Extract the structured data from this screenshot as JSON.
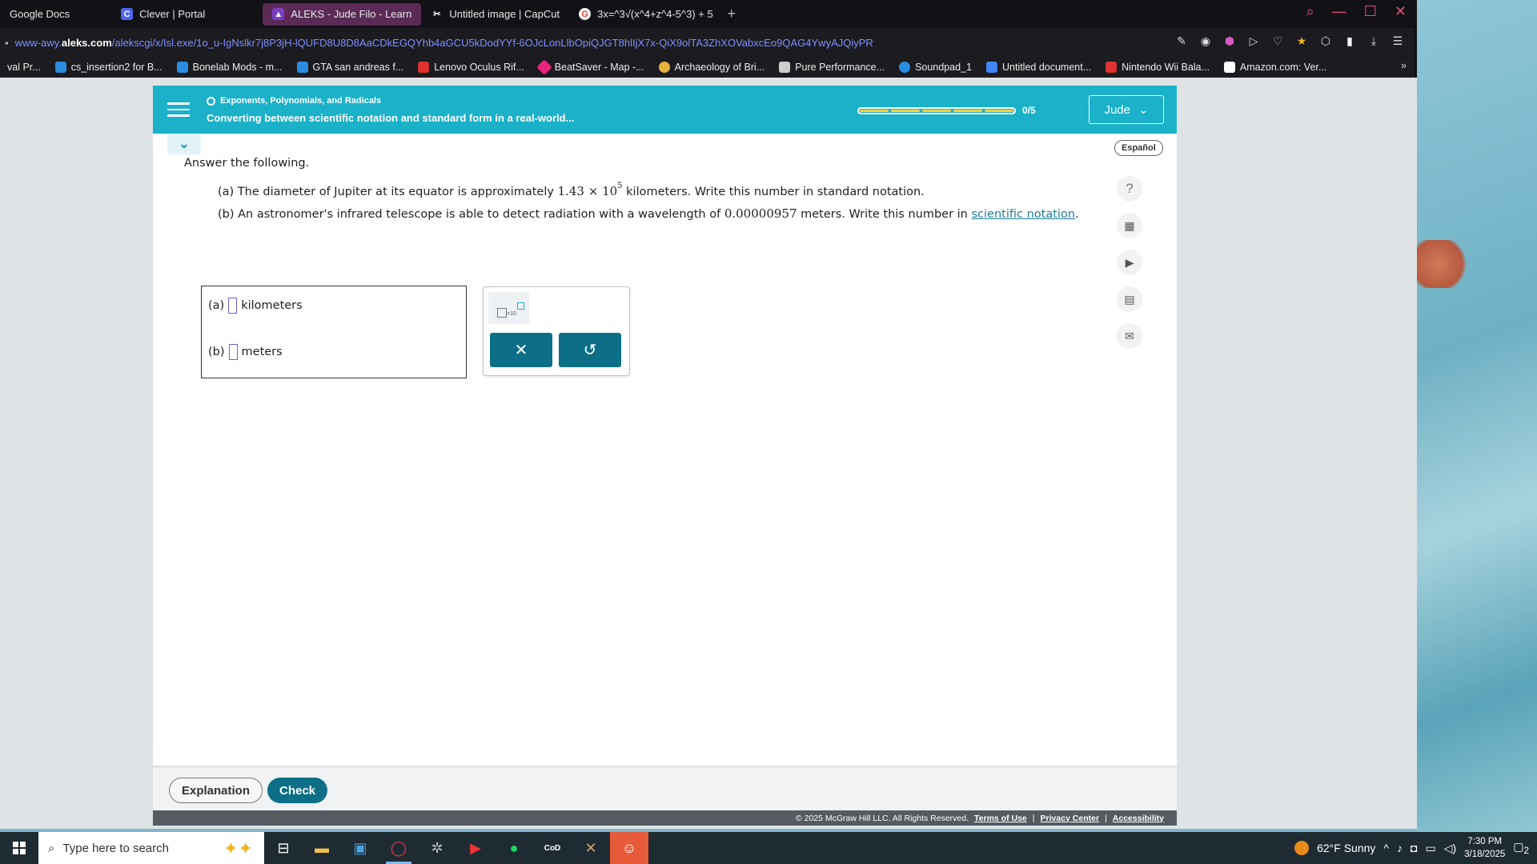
{
  "browser": {
    "tabs": [
      {
        "label": "Google Docs",
        "color": "#4285f4",
        "icon": "docs-icon"
      },
      {
        "label": "Clever | Portal",
        "color": "#4f67ef",
        "icon": "clever-icon",
        "glyph": "C"
      },
      {
        "label": "ALEKS - Jude Filo - Learn",
        "color": "#7b3fbf",
        "icon": "aleks-icon",
        "active": true
      },
      {
        "label": "Untitled image | CapCut",
        "color": "#ffffff",
        "icon": "capcut-icon"
      },
      {
        "label": "3x=^3√(x^4+z^4-5^3) + 5",
        "color": "#ea4335",
        "icon": "google-icon"
      }
    ],
    "new_tab": "+",
    "url_prefix": "www-awy.",
    "url_domain": "aleks.com",
    "url_rest": "/alekscgi/x/Isl.exe/1o_u-IgNslkr7j8P3jH-lQUFD8U8D8AaCDkEGQYhb4aGCU5kDodYYf-6OJcLonLlbOpiQJGT8hlIjX7x-QiX9olTA3ZhXOVabxcEo9QAG4YwyAJQiyPR",
    "bookmarks": [
      {
        "label": "val Pr...",
        "color": "#555"
      },
      {
        "label": "cs_insertion2 for B...",
        "color": "#2b8de0"
      },
      {
        "label": "Bonelab Mods - m...",
        "color": "#2b8de0"
      },
      {
        "label": "GTA san andreas f...",
        "color": "#2b8de0"
      },
      {
        "label": "Lenovo Oculus Rif...",
        "color": "#d33"
      },
      {
        "label": "BeatSaver - Map -...",
        "color": "#e6267b"
      },
      {
        "label": "Archaeology of Bri...",
        "color": "#e8b13a"
      },
      {
        "label": "Pure Performance...",
        "color": "#ccc"
      },
      {
        "label": "Soundpad_1",
        "color": "#2b8de0"
      },
      {
        "label": "Untitled document...",
        "color": "#4285f4"
      },
      {
        "label": "Nintendo Wii Bala...",
        "color": "#d33"
      },
      {
        "label": "Amazon.com: Ver...",
        "color": "#fff"
      }
    ]
  },
  "aleks": {
    "topic": "Exponents, Polynomials, and Radicals",
    "lesson": "Converting between scientific notation and standard form in a real-world...",
    "progress": {
      "completed": 0,
      "total": 5,
      "label": "0/5",
      "segments": 5
    },
    "user": "Jude",
    "language_button": "Español",
    "instruction": "Answer the following.",
    "part_a": {
      "prefix": "(a) The diameter of Jupiter at its equator is approximately",
      "mantissa": "1.43 × 10",
      "exponent": "5",
      "suffix": "kilometers. Write this number in standard notation."
    },
    "part_b": {
      "prefix": "(b) An astronomer's infrared telescope is able to detect radiation with a wavelength of",
      "value": "0.00000957",
      "middle": "meters. Write this number in",
      "link": "scientific notation",
      "end": "."
    },
    "answers": [
      {
        "label": "(a)",
        "unit": "kilometers",
        "value": ""
      },
      {
        "label": "(b)",
        "unit": "meters",
        "value": ""
      }
    ],
    "keypad": {
      "sci_key_label": "×10",
      "clear": "✕",
      "undo": "↺"
    },
    "tools": [
      "help-icon",
      "calculator-icon",
      "video-icon",
      "textbook-icon",
      "mail-icon"
    ],
    "footer": {
      "explanation": "Explanation",
      "check": "Check",
      "copyright": "© 2025 McGraw Hill LLC. All Rights Reserved.",
      "terms": "Terms of Use",
      "privacy": "Privacy Center",
      "accessibility": "Accessibility"
    }
  },
  "taskbar": {
    "search_placeholder": "Type here to search",
    "weather": "62°F  Sunny",
    "time": "7:30 PM",
    "date": "3/18/2025",
    "notifications": "2"
  }
}
